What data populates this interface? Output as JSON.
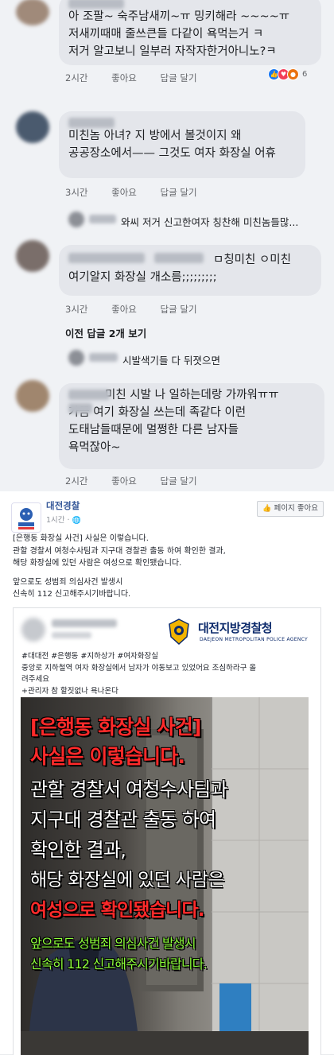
{
  "comments": [
    {
      "lines": [
        "아 조팔~ 숙주남새끼~ㅠ 밍키해라 ~~~~ㅠ",
        "저새끼때매 줄쓰큰들 다같이 욕먹는거 ㅋ",
        "저거 알고보니 일부러 자작자한거아니노?ㅋ"
      ],
      "time": "2시간",
      "like": "좋아요",
      "reply": "답글 달기",
      "reaction_count": "6"
    },
    {
      "lines": [
        "미친놈 아녀? 지 방에서 볼것이지 왜",
        "공공장소에서—— 그것도 여자 화장실 어휴"
      ],
      "time": "3시간",
      "like": "좋아요",
      "reply": "답글 달기"
    },
    {
      "lines": [
        "ㅁ칭미친 ㅇ미친",
        "여기알지 화장실 개소름;;;;;;;;;"
      ],
      "time": "3시간",
      "like": "좋아요",
      "reply": "답글 달기"
    },
    {
      "lines": [
        "미친 시발 나 일하는데랑 가까워ㅠㅠ",
        "가끔 여기 화장실 쓰는데 족같다 이런",
        "도태남들때문에 멀쩡한 다른 남자들",
        "욕먹잖아~"
      ],
      "time": "2시간",
      "like": "좋아요",
      "reply": "답글 달기"
    }
  ],
  "reply_previews": [
    {
      "text": "와씨 저거 신고한여자 칭찬해 미친놈들많..."
    },
    {
      "text": "시발색기들 다 뒤졋으면"
    }
  ],
  "view_more_replies": "이전 답글 2개 보기",
  "post": {
    "page_name": "대전경찰",
    "time": "1시간 · ",
    "like_page_button": "페이지 좋아요",
    "text_lines": [
      "[은행동 화장실 사건] 사실은 이렇습니다.",
      "관할 경찰서 여청수사팀과 지구대 경찰관 출동 하여 확인한 결과,",
      "해당 화장실에 있던 사람은 여성으로 확인됐습니다."
    ],
    "text_lines_2": [
      "앞으로도 성범죄 의심사건 발생시",
      "신속히 112 신고해주시기바랍니다."
    ]
  },
  "embed": {
    "org_name": "대전지방경찰청",
    "org_sub": "DAEJEON METROPOLITAN POLICE AGENCY",
    "text_lines": [
      "#대대전 #은행동 #지하상가 #여자화장실",
      "중앙로 지하철역 여자 화장실에서 남자가 야동보고 있었어요 조심하라구 올",
      "려주세요",
      "+관리자 참 할짓없나 욕나온다"
    ]
  },
  "overlay": {
    "line1": "[은행동 화장실 사건]",
    "line2": "사실은 이렇습니다.",
    "line3": "관할 경찰서 여청수사팀과",
    "line4": "지구대 경찰관 출동 하여",
    "line5": "확인한 결과,",
    "line6": "해당 화장실에 있던 사람은",
    "line7": "여성으로 확인됐습니다.",
    "line8": "앞으로도 성범죄 의심사건 발생시",
    "line9": "신속히 112 신고해주시기바랍니다."
  },
  "colors": {
    "bubble": "#e4e6eb",
    "link": "#365899",
    "overlay_red": "#ff2a2a",
    "overlay_green": "#8dff3a"
  }
}
